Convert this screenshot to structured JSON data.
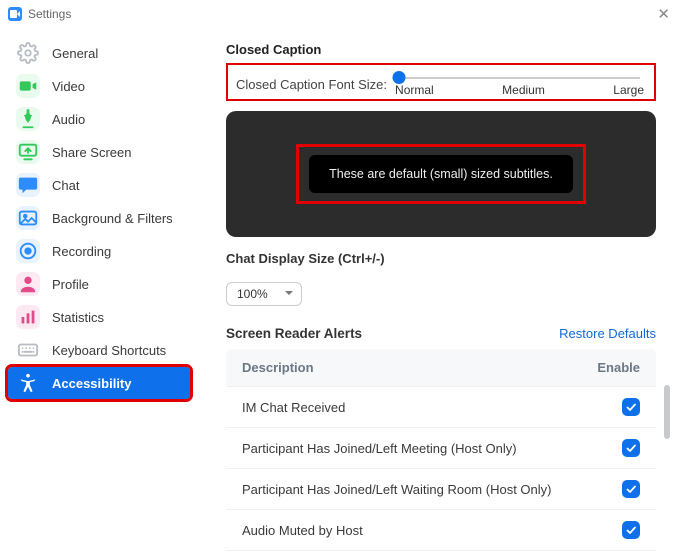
{
  "window": {
    "title": "Settings"
  },
  "sidebar": {
    "items": [
      {
        "label": "General"
      },
      {
        "label": "Video"
      },
      {
        "label": "Audio"
      },
      {
        "label": "Share Screen"
      },
      {
        "label": "Chat"
      },
      {
        "label": "Background & Filters"
      },
      {
        "label": "Recording"
      },
      {
        "label": "Profile"
      },
      {
        "label": "Statistics"
      },
      {
        "label": "Keyboard Shortcuts"
      },
      {
        "label": "Accessibility"
      }
    ]
  },
  "cc": {
    "section_title": "Closed Caption",
    "label": "Closed Caption Font Size:",
    "ticks": {
      "normal": "Normal",
      "medium": "Medium",
      "large": "Large"
    },
    "preview_text": "These are default (small) sized subtitles."
  },
  "chat_size": {
    "label": "Chat Display Size (Ctrl+/-)",
    "value": "100%"
  },
  "sr": {
    "title": "Screen Reader Alerts",
    "restore": "Restore Defaults",
    "cols": {
      "desc": "Description",
      "enable": "Enable"
    },
    "rows": [
      {
        "desc": "IM Chat Received"
      },
      {
        "desc": "Participant Has Joined/Left Meeting (Host Only)"
      },
      {
        "desc": "Participant Has Joined/Left Waiting Room (Host Only)"
      },
      {
        "desc": "Audio Muted by Host"
      }
    ]
  }
}
